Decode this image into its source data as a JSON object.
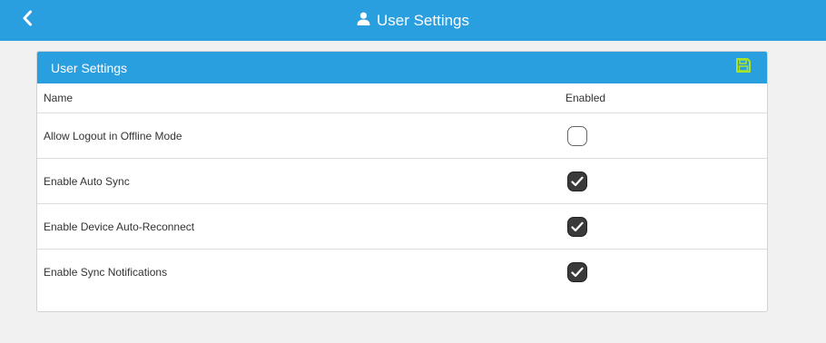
{
  "topbar": {
    "title": "User Settings",
    "back_icon": "chevron-left-icon",
    "title_icon": "user-icon",
    "color": "#2a9fe0"
  },
  "panel": {
    "title": "User Settings",
    "save_icon": "save-icon",
    "save_icon_color": "#a6e22e",
    "columns": {
      "name": "Name",
      "enabled": "Enabled"
    },
    "rows": [
      {
        "name": "Allow Logout in Offline Mode",
        "enabled": false
      },
      {
        "name": "Enable Auto Sync",
        "enabled": true
      },
      {
        "name": "Enable Device Auto-Reconnect",
        "enabled": true
      },
      {
        "name": "Enable Sync Notifications",
        "enabled": true
      }
    ]
  }
}
